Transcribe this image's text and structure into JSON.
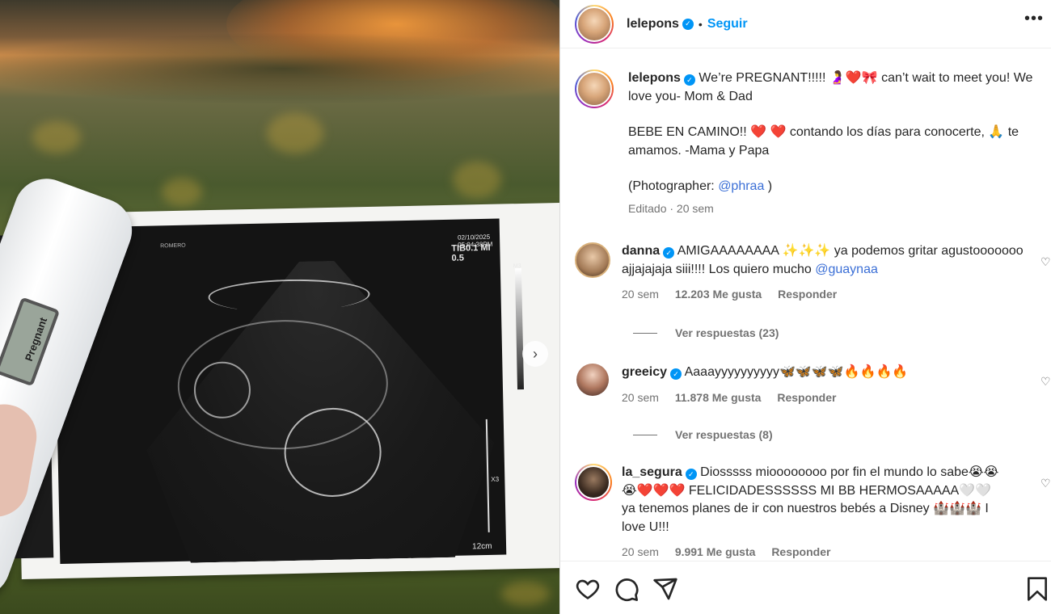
{
  "media": {
    "scan": {
      "date": "02/10/2025 05:04:38PM",
      "params": "TIB0.1  MI 0.5",
      "name": "ROMERO",
      "m3": "M3",
      "cm": "12cm",
      "x3": "X3"
    },
    "test": {
      "window_text": "Pregnant",
      "brand": "blue"
    },
    "next_icon": "chevron-right-icon"
  },
  "header": {
    "username": "lelepons",
    "separator": "•",
    "follow_label": "Seguir",
    "more_label": "•••"
  },
  "caption": {
    "username": "lelepons",
    "p1": "We’re PREGNANT!!!!! 🤰❤️🎀 can’t wait to meet you! We love you- Mom & Dad",
    "p2": "BEBE EN CAMINO!! ❤️ ❤️ contando los días para conocerte, 🙏 te amamos. -Mama y Papa",
    "p3_prefix": "(Photographer: ",
    "p3_mention": "@phraa",
    "p3_suffix": " )",
    "meta": "Editado · 20 sem"
  },
  "comments": [
    {
      "username": "danna",
      "text": "AMIGAAAAAAAA ✨✨✨ ya podemos gritar agustooooooo ajjajajaja siii!!!! Los quiero mucho ",
      "mention": "@guaynaa",
      "time": "20 sem",
      "likes": "12.203 Me gusta",
      "reply": "Responder",
      "replies": "Ver respuestas (23)"
    },
    {
      "username": "greeicy",
      "text": "Aaaayyyyyyyyyy🦋🦋🦋🦋🔥🔥🔥🔥",
      "mention": "",
      "time": "20 sem",
      "likes": "11.878 Me gusta",
      "reply": "Responder",
      "replies": "Ver respuestas (8)"
    },
    {
      "username": "la_segura",
      "text": "Diosssss mioooooooo por fin el mundo lo sabe😭😭😭❤️❤️❤️ FELICIDADESSSSSS MI BB HERMOSAAAAA🤍🤍 ya tenemos planes de ir con nuestros bebés a Disney 🏰🏰🏰 I love U!!!",
      "mention": "",
      "time": "20 sem",
      "likes": "9.991 Me gusta",
      "reply": "Responder"
    }
  ],
  "actions": {
    "like": "heart-icon",
    "comment": "comment-icon",
    "share": "send-icon",
    "save": "bookmark-icon"
  },
  "colors": {
    "link": "#0095f6",
    "verified": "#0095f6",
    "secondary_text": "#737373"
  }
}
